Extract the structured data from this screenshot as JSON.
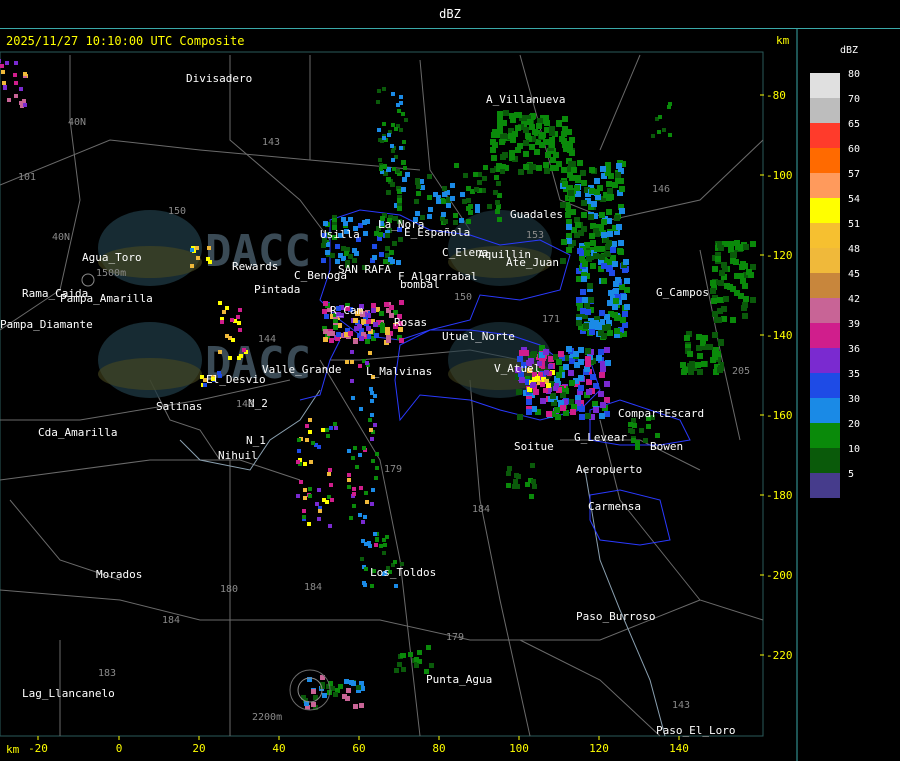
{
  "header": {
    "title": "dBZ"
  },
  "map": {
    "timestamp_title": "2025/11/27 10:10:00 UTC Composite",
    "km_top": "km",
    "km_bottom": "km",
    "x_ticks": [
      "-20",
      "0",
      "20",
      "40",
      "60",
      "80",
      "100",
      "120",
      "140"
    ],
    "y_ticks": [
      "-80",
      "-100",
      "-120",
      "-140",
      "-160",
      "-180",
      "-200",
      "-220"
    ],
    "places": [
      {
        "name": "Divisadero"
      },
      {
        "name": "A_Villanueva"
      },
      {
        "name": "Guadales"
      },
      {
        "name": "La_Nora"
      },
      {
        "name": "Usilla"
      },
      {
        "name": "E_Española"
      },
      {
        "name": "C_Elena"
      },
      {
        "name": "Aquillin"
      },
      {
        "name": "Ate_Juan"
      },
      {
        "name": "G_Campos"
      },
      {
        "name": "Rewards"
      },
      {
        "name": "C_Benoga"
      },
      {
        "name": "SAN RAFA"
      },
      {
        "name": "F_Algarrabal"
      },
      {
        "name": "bombal"
      },
      {
        "name": "Pintada"
      },
      {
        "name": "R_Cam"
      },
      {
        "name": "Rosas"
      },
      {
        "name": "Utuel_Norte"
      },
      {
        "name": "Valle_Grande"
      },
      {
        "name": "L_Malvinas"
      },
      {
        "name": "V_Atuel"
      },
      {
        "name": "Salinas"
      },
      {
        "name": "El_Desvio"
      },
      {
        "name": "N_2"
      },
      {
        "name": "N_1"
      },
      {
        "name": "Nihuil"
      },
      {
        "name": "Cda_Amarilla"
      },
      {
        "name": "Agua_Toro"
      },
      {
        "name": "Pampa_Diamante"
      },
      {
        "name": "CompartEscard"
      },
      {
        "name": "G_Levear"
      },
      {
        "name": "Bowen"
      },
      {
        "name": "Aeropuerto"
      },
      {
        "name": "Carmensa"
      },
      {
        "name": "Morados"
      },
      {
        "name": "Los_Toldos"
      },
      {
        "name": "Paso_Burroso"
      },
      {
        "name": "Punta_Agua"
      },
      {
        "name": "Lag_Llancanelo"
      },
      {
        "name": "Paso_El_Loro"
      },
      {
        "name": "Soitue"
      },
      {
        "name": "Pampa_Amarilla"
      },
      {
        "name": "Rama_Caida"
      }
    ],
    "route_labels": [
      "143",
      "40N",
      "101",
      "150",
      "40N",
      "144",
      "140",
      "179",
      "184",
      "180",
      "184",
      "183",
      "179",
      "153",
      "146",
      "171",
      "205",
      "150",
      "143",
      "184"
    ],
    "elevation_labels": [
      "1500m",
      "2200m"
    ],
    "watermark_labels": [
      "DACC",
      "DACC"
    ]
  },
  "legend": {
    "title": "dBZ",
    "items": [
      {
        "label": "80",
        "color": "#e0e0e0"
      },
      {
        "label": "70",
        "color": "#bdbdbd"
      },
      {
        "label": "65",
        "color": "#ff3b2b"
      },
      {
        "label": "60",
        "color": "#ff6a00"
      },
      {
        "label": "57",
        "color": "#ff9a5c"
      },
      {
        "label": "54",
        "color": "#ffff00"
      },
      {
        "label": "51",
        "color": "#f6c030"
      },
      {
        "label": "48",
        "color": "#f0b93a"
      },
      {
        "label": "45",
        "color": "#c8863c"
      },
      {
        "label": "42",
        "color": "#c86496"
      },
      {
        "label": "39",
        "color": "#d01e8c"
      },
      {
        "label": "36",
        "color": "#7a2ad0"
      },
      {
        "label": "35",
        "color": "#1e4be6"
      },
      {
        "label": "30",
        "color": "#1a8ae6"
      },
      {
        "label": "20",
        "color": "#0a8a0a"
      },
      {
        "label": "10",
        "color": "#0a5a0a"
      },
      {
        "label": "5",
        "color": "#463c8c"
      }
    ]
  }
}
